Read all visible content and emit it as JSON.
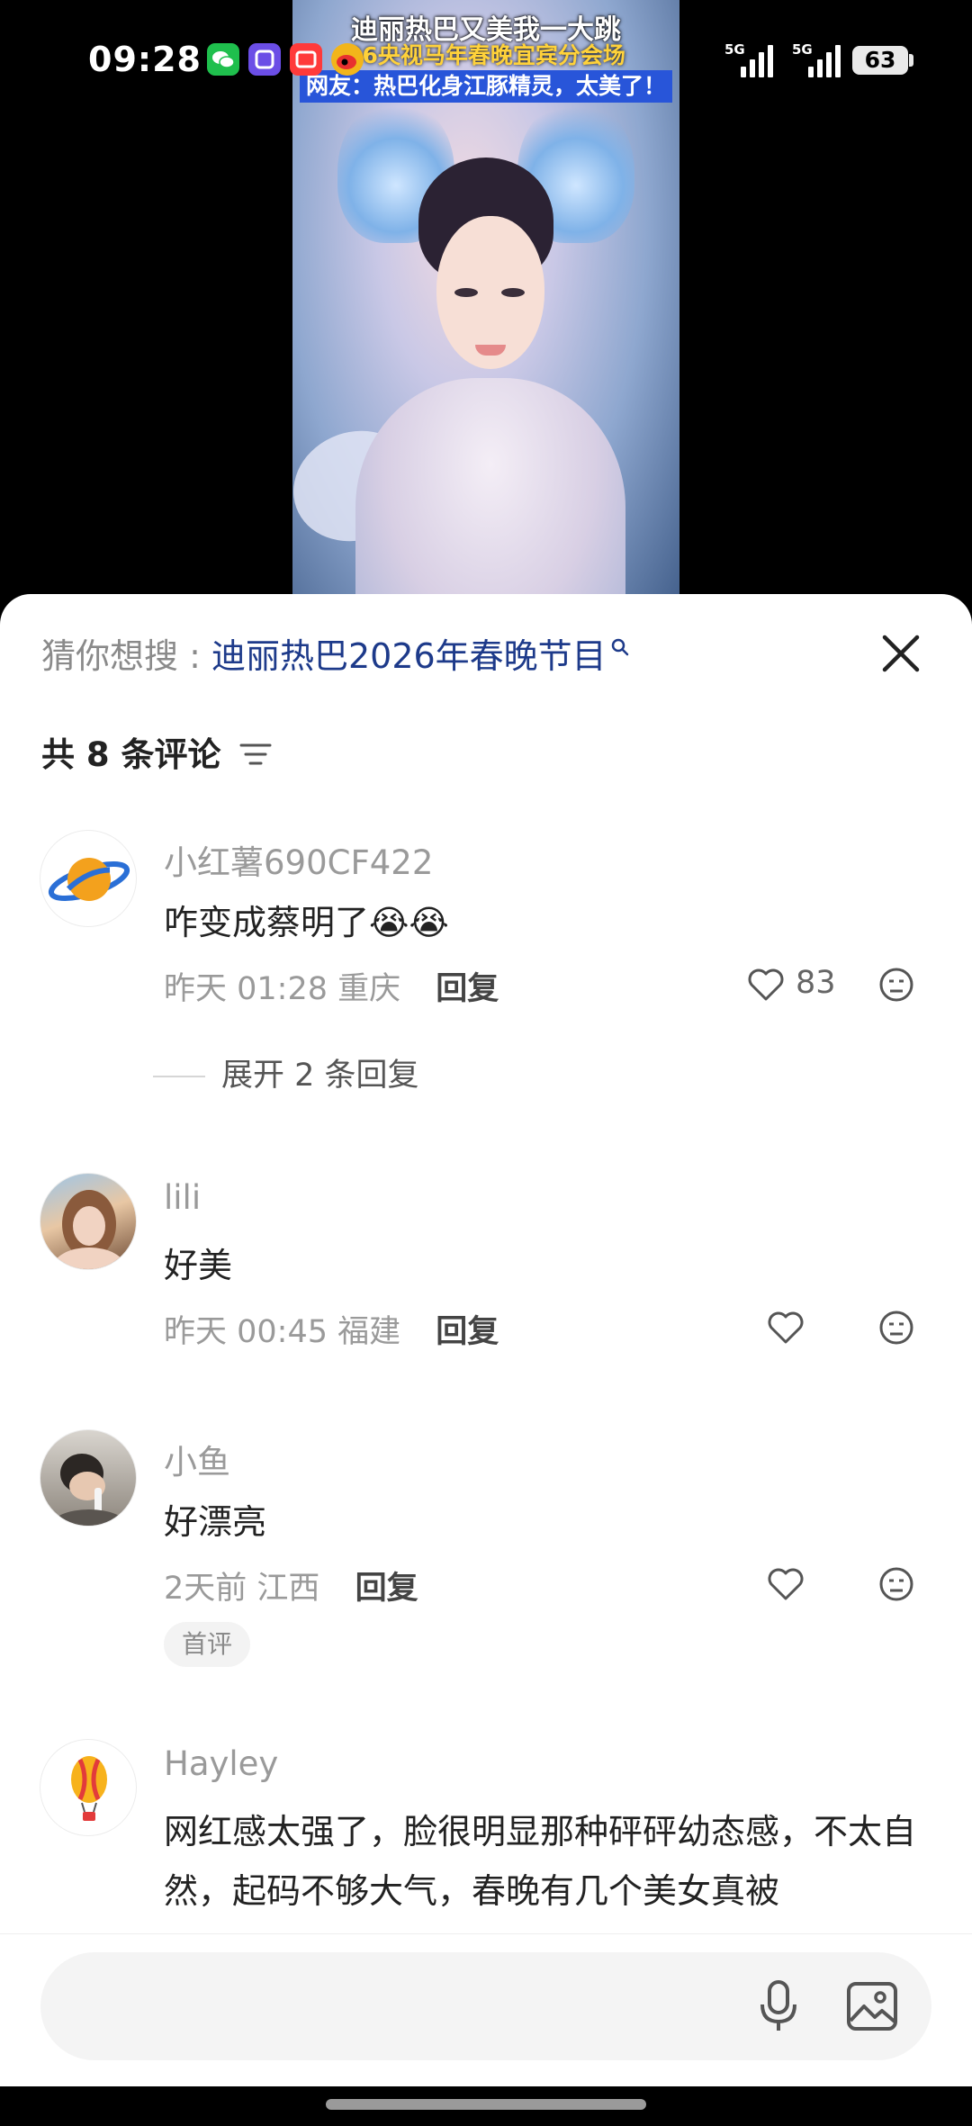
{
  "status_bar": {
    "time": "09:28",
    "network_1": "5G",
    "network_2": "5G",
    "battery": "63",
    "app_icons": [
      "wechat-icon",
      "tieba-icon",
      "taobao-icon",
      "weibo-icon"
    ]
  },
  "video": {
    "title_line1": "迪丽热巴又美我一大跳",
    "title_line2": "26央视马年春晚宜宾分会场",
    "title_line3": "网友：热巴化身江豚精灵，太美了！"
  },
  "sheet": {
    "suggest_label": "猜你想搜 : ",
    "suggest_query": "迪丽热巴2026年春晚节目",
    "comment_count": "共 8 条评论",
    "comments": [
      {
        "user": "小红薯690CF422",
        "text": "咋变成蔡明了😭😭",
        "time": "昨天 01:28",
        "location": "重庆",
        "reply": "回复",
        "likes": "83",
        "expand": "展开 2 条回复",
        "avatar_icon": "planet-icon"
      },
      {
        "user": "lili",
        "text": "好美",
        "time": "昨天 00:45",
        "location": "福建",
        "reply": "回复",
        "avatar_icon": "user-photo"
      },
      {
        "user": "小鱼",
        "text": "好漂亮",
        "time": "2天前",
        "location": "江西",
        "reply": "回复",
        "badge": "首评",
        "avatar_icon": "user-photo"
      },
      {
        "user": "Hayley",
        "text": "网红感太强了，脸很明显那种砰砰幼态感，不太自然，起码不够大气，春晚有几个美女真被",
        "avatar_icon": "balloon-icon"
      }
    ]
  },
  "input": {
    "placeholder": ""
  },
  "colors": {
    "query_blue": "#1d3a8a",
    "meta_gray": "#9a9a9a",
    "sheet_bg": "#ffffff"
  }
}
